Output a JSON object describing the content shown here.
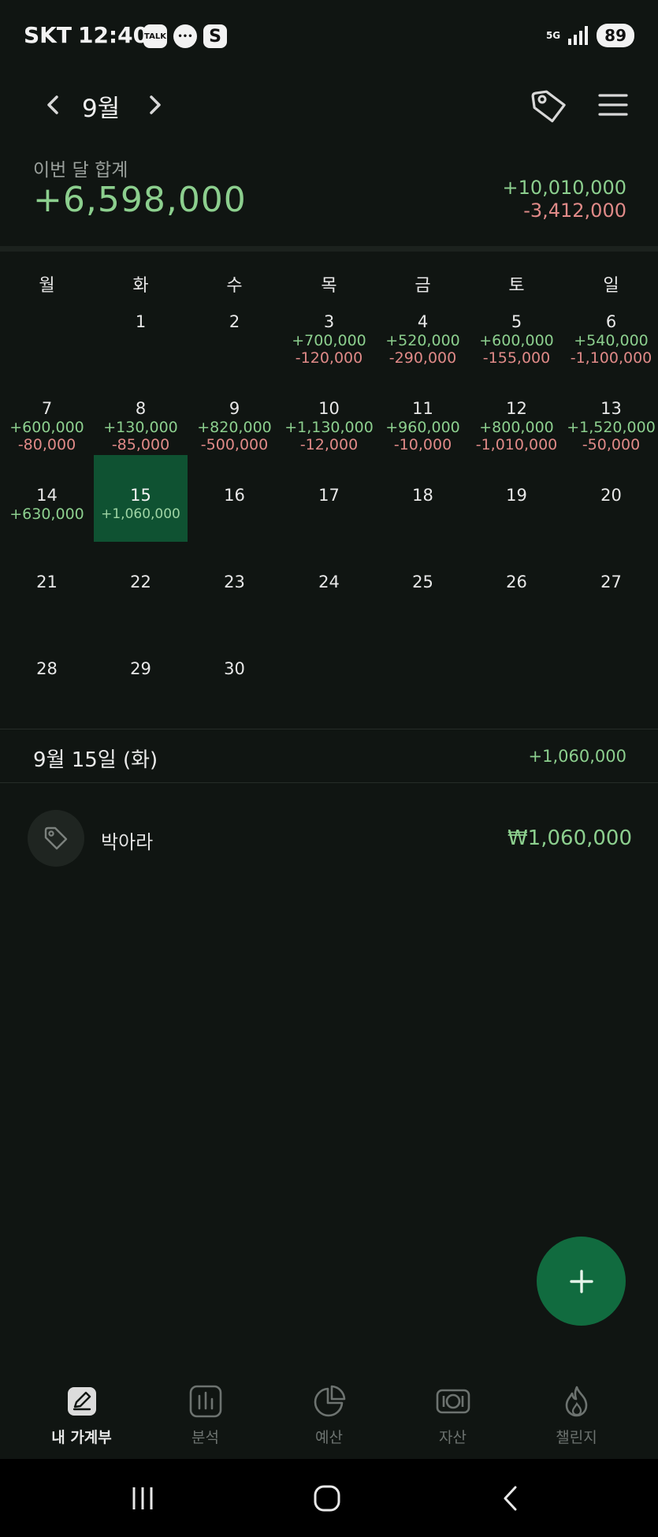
{
  "status_bar": {
    "carrier": "SKT",
    "time": "12:40",
    "notification_icons": [
      "TALK",
      "",
      "S"
    ],
    "network": "5G",
    "battery": "89"
  },
  "header": {
    "month": "9월"
  },
  "summary": {
    "label": "이번 달 합계",
    "total": "+6,598,000",
    "income": "+10,010,000",
    "expense": "-3,412,000"
  },
  "calendar": {
    "weekdays": [
      "월",
      "화",
      "수",
      "목",
      "금",
      "토",
      "일"
    ],
    "days": [
      {
        "d": "1"
      },
      {
        "d": "2"
      },
      {
        "d": "3",
        "inc": "+700,000",
        "exp": "-120,000"
      },
      {
        "d": "4",
        "inc": "+520,000",
        "exp": "-290,000"
      },
      {
        "d": "5",
        "inc": "+600,000",
        "exp": "-155,000"
      },
      {
        "d": "6",
        "inc": "+540,000",
        "exp": "-1,100,000"
      },
      {
        "d": "7",
        "inc": "+600,000",
        "exp": "-80,000"
      },
      {
        "d": "8",
        "inc": "+130,000",
        "exp": "-85,000"
      },
      {
        "d": "9",
        "inc": "+820,000",
        "exp": "-500,000"
      },
      {
        "d": "10",
        "inc": "+1,130,000",
        "exp": "-12,000"
      },
      {
        "d": "11",
        "inc": "+960,000",
        "exp": "-10,000"
      },
      {
        "d": "12",
        "inc": "+800,000",
        "exp": "-1,010,000"
      },
      {
        "d": "13",
        "inc": "+1,520,000",
        "exp": "-50,000"
      },
      {
        "d": "14",
        "inc": "+630,000"
      },
      {
        "d": "15",
        "inc": "+1,060,000",
        "selected": true
      },
      {
        "d": "16"
      },
      {
        "d": "17"
      },
      {
        "d": "18"
      },
      {
        "d": "19"
      },
      {
        "d": "20"
      },
      {
        "d": "21"
      },
      {
        "d": "22"
      },
      {
        "d": "23"
      },
      {
        "d": "24"
      },
      {
        "d": "25"
      },
      {
        "d": "26"
      },
      {
        "d": "27"
      },
      {
        "d": "28"
      },
      {
        "d": "29"
      },
      {
        "d": "30"
      }
    ]
  },
  "selected_day": {
    "title": "9월 15일 (화)",
    "total": "+1,060,000",
    "transactions": [
      {
        "name": "박아라",
        "amount": "₩1,060,000",
        "icon": "tag-icon"
      }
    ]
  },
  "fab": {
    "icon": "plus-icon"
  },
  "bottom_nav": [
    {
      "label": "내 가계부",
      "icon": "ledger-edit-icon",
      "active": true
    },
    {
      "label": "분석",
      "icon": "bar-chart-icon"
    },
    {
      "label": "예산",
      "icon": "pie-chart-icon"
    },
    {
      "label": "자산",
      "icon": "money-icon"
    },
    {
      "label": "챌린지",
      "icon": "fire-icon"
    }
  ],
  "colors": {
    "background": "#101512",
    "income": "#8ccf8e",
    "expense": "#e08a88",
    "accent": "#116b3f"
  }
}
